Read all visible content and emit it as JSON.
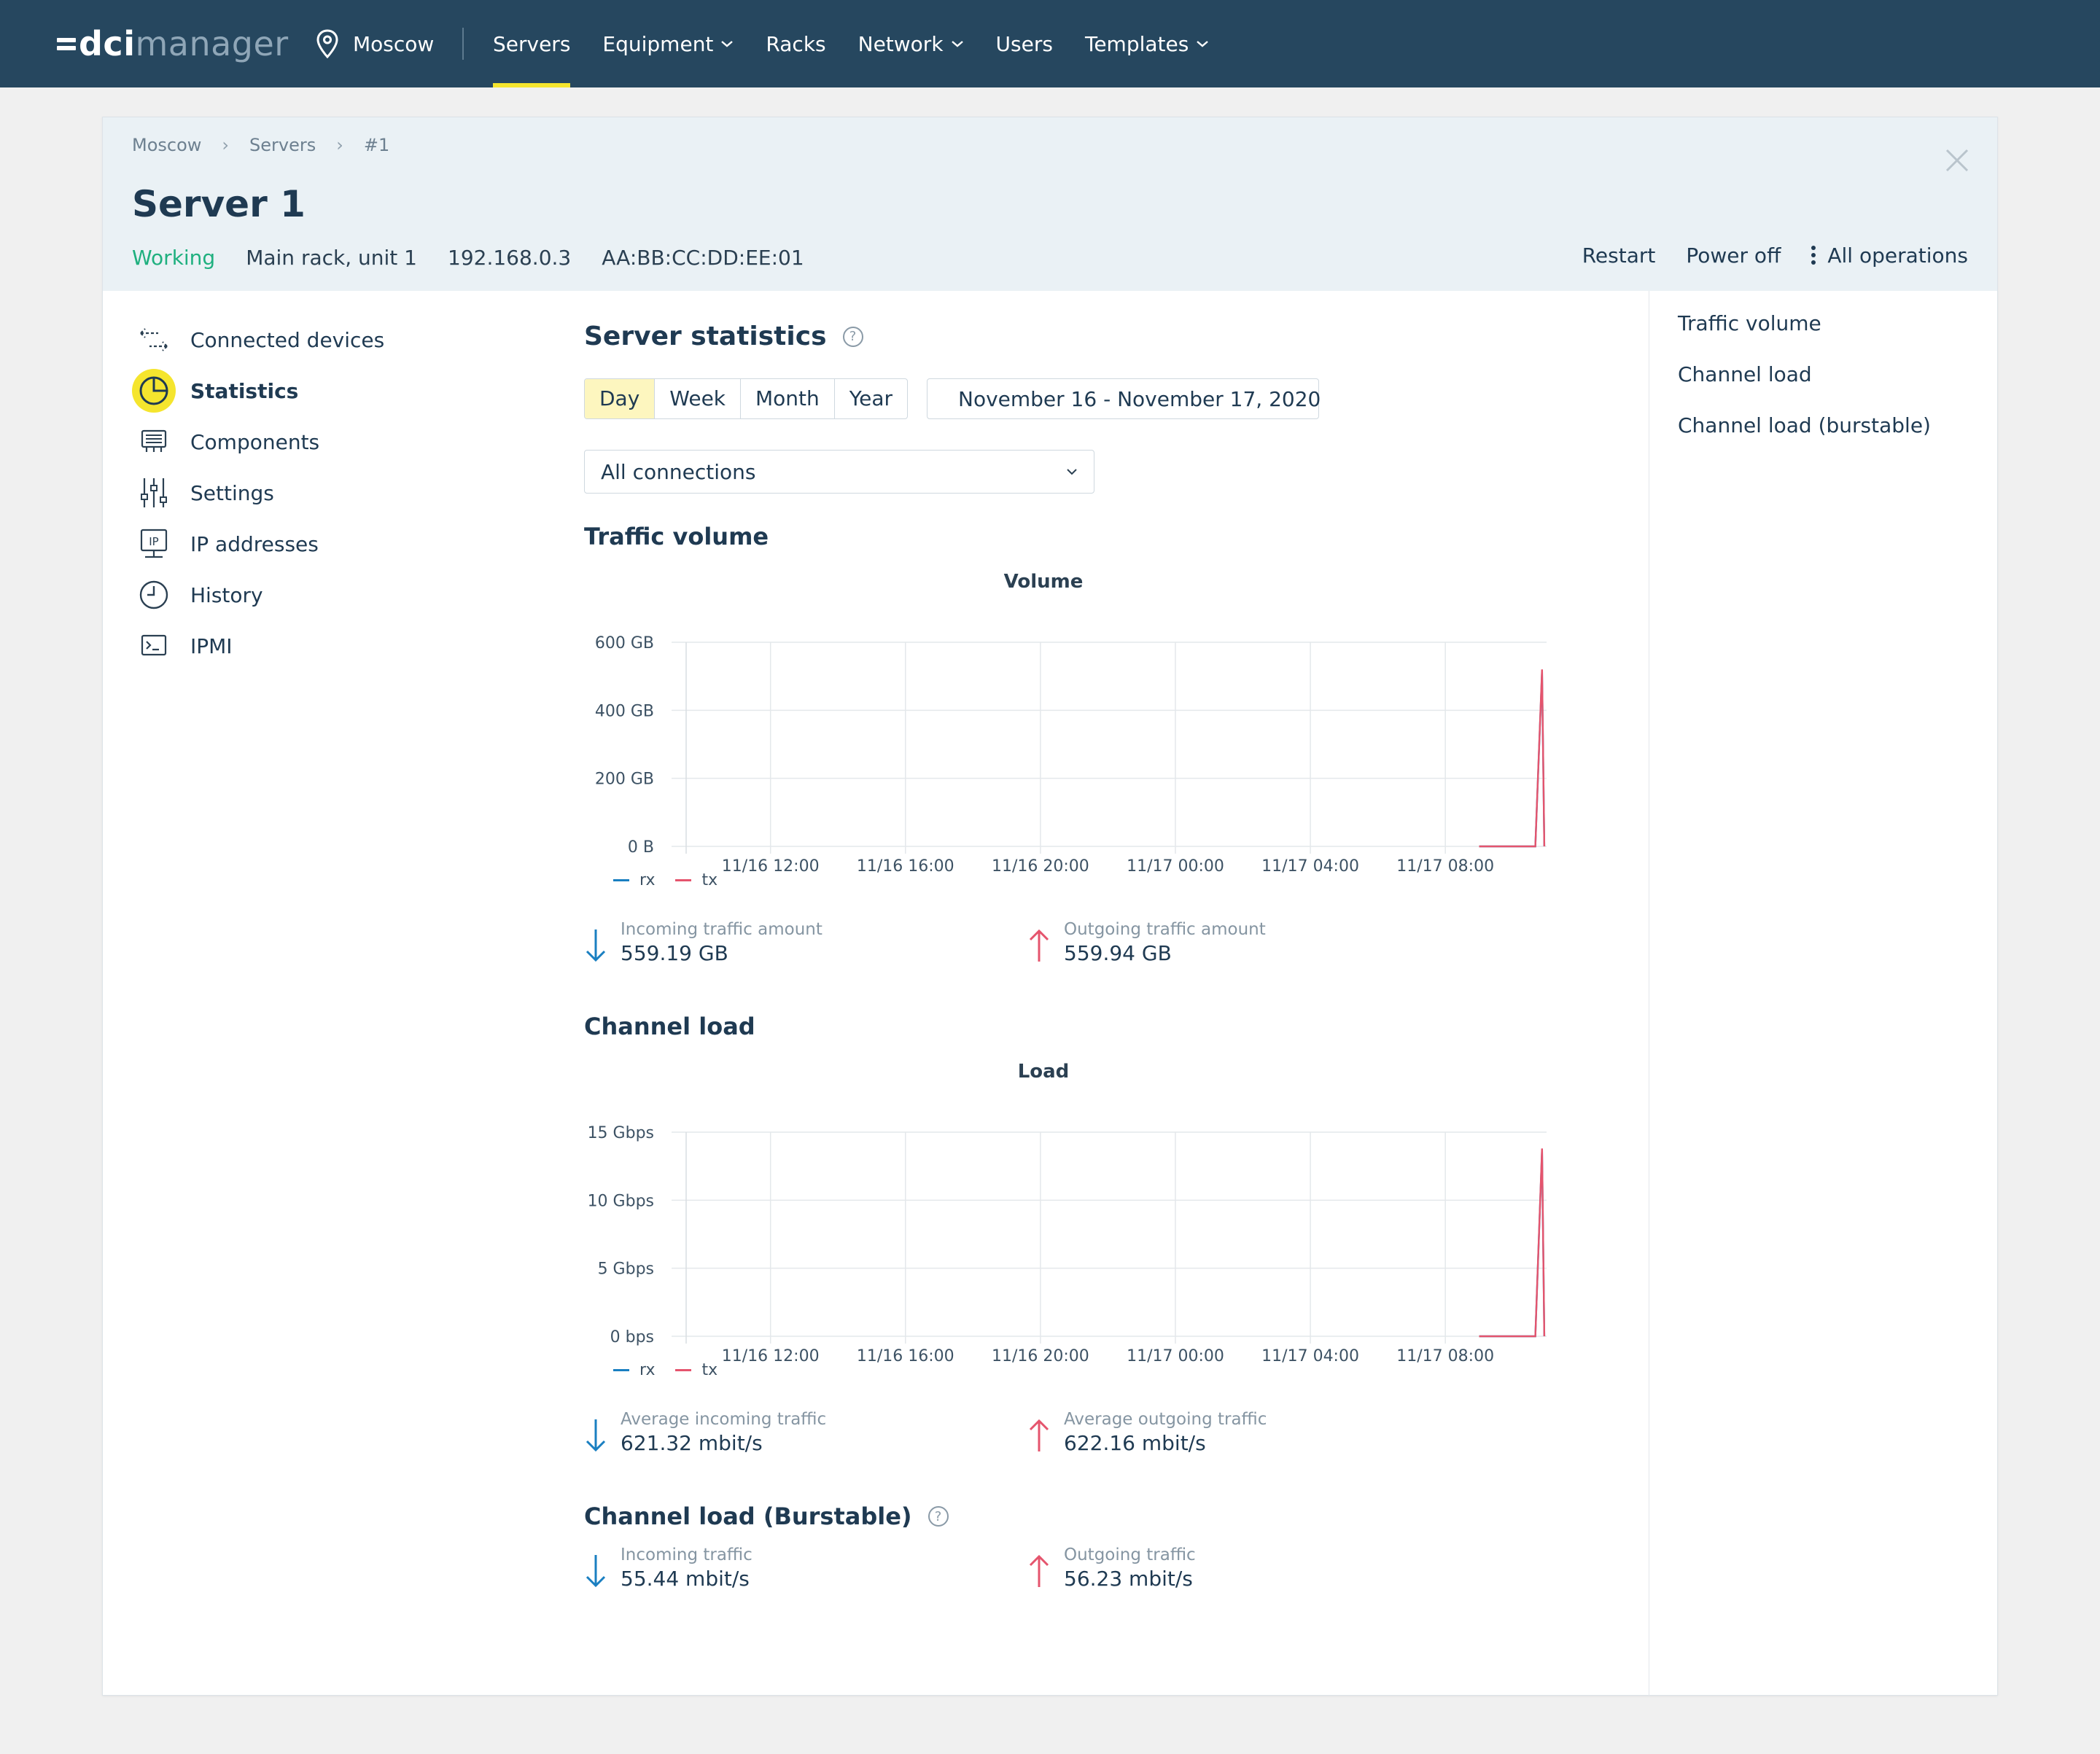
{
  "app": {
    "logo_dci": "dci",
    "logo_manager": "manager",
    "location": "Moscow"
  },
  "nav": [
    {
      "label": "Servers",
      "dropdown": false,
      "active": true
    },
    {
      "label": "Equipment",
      "dropdown": true,
      "active": false
    },
    {
      "label": "Racks",
      "dropdown": false,
      "active": false
    },
    {
      "label": "Network",
      "dropdown": true,
      "active": false
    },
    {
      "label": "Users",
      "dropdown": false,
      "active": false
    },
    {
      "label": "Templates",
      "dropdown": true,
      "active": false
    }
  ],
  "breadcrumb": [
    "Moscow",
    "Servers",
    "#1"
  ],
  "breadcrumb_sep": "›",
  "server": {
    "title": "Server 1",
    "status": "Working",
    "rack": "Main rack, unit 1",
    "ip": "192.168.0.3",
    "mac": "AA:BB:CC:DD:EE:01"
  },
  "actions": {
    "restart": "Restart",
    "power_off": "Power off",
    "all_operations": "All operations"
  },
  "sidemenu": [
    {
      "label": "Connected devices",
      "icon": "connected-devices-icon"
    },
    {
      "label": "Statistics",
      "icon": "pie-chart-icon",
      "active": true
    },
    {
      "label": "Components",
      "icon": "components-icon"
    },
    {
      "label": "Settings",
      "icon": "sliders-icon"
    },
    {
      "label": "IP addresses",
      "icon": "ip-icon"
    },
    {
      "label": "History",
      "icon": "clock-icon"
    },
    {
      "label": "IPMI",
      "icon": "terminal-icon"
    }
  ],
  "rightmenu": [
    "Traffic volume",
    "Channel load",
    "Channel load (burstable)"
  ],
  "stats": {
    "title": "Server statistics",
    "help": "?",
    "periods": [
      "Day",
      "Week",
      "Month",
      "Year"
    ],
    "active_period": "Day",
    "date_range": "November 16 - November 17, 2020",
    "connection_select": "All connections"
  },
  "traffic": {
    "heading": "Traffic volume",
    "in_label": "Incoming traffic amount",
    "in_value": "559.19 GB",
    "out_label": "Outgoing traffic amount",
    "out_value": "559.94 GB"
  },
  "load": {
    "heading": "Channel load",
    "in_label": "Average incoming traffic",
    "in_value": "621.32 mbit/s",
    "out_label": "Average outgoing traffic",
    "out_value": "622.16 mbit/s"
  },
  "burst": {
    "heading": "Channel load (Burstable)",
    "help": "?",
    "in_label": "Incoming traffic",
    "in_value": "55.44 mbit/s",
    "out_label": "Outgoing traffic",
    "out_value": "56.23 mbit/s"
  },
  "colors": {
    "rx": "#1a7fc1",
    "tx": "#e5546d",
    "accent": "#f5e52e",
    "status_ok": "#1fb07f"
  },
  "chart_data": [
    {
      "type": "line",
      "title": "Volume",
      "y_ticks": [
        "0 B",
        "200 GB",
        "400 GB",
        "600 GB"
      ],
      "ylim": [
        0,
        600
      ],
      "y_unit": "GB",
      "x_ticks": [
        "11/16 12:00",
        "11/16 16:00",
        "11/16 20:00",
        "11/17 00:00",
        "11/17 04:00",
        "11/17 08:00"
      ],
      "x_range": [
        "11/16 09:30",
        "11/17 11:00"
      ],
      "series": [
        {
          "name": "rx",
          "x": [
            "11/17 09:00",
            "11/17 10:40",
            "11/17 10:52",
            "11/17 10:56"
          ],
          "values": [
            0,
            0,
            515,
            0
          ]
        },
        {
          "name": "tx",
          "x": [
            "11/17 09:00",
            "11/17 10:40",
            "11/17 10:52",
            "11/17 10:56"
          ],
          "values": [
            0,
            0,
            520,
            0
          ]
        }
      ],
      "grid": true,
      "legend": "bottom-left"
    },
    {
      "type": "line",
      "title": "Load",
      "y_ticks": [
        "0 bps",
        "5 Gbps",
        "10 Gbps",
        "15 Gbps"
      ],
      "ylim": [
        0,
        15
      ],
      "y_unit": "Gbps",
      "x_ticks": [
        "11/16 12:00",
        "11/16 16:00",
        "11/16 20:00",
        "11/17 00:00",
        "11/17 04:00",
        "11/17 08:00"
      ],
      "x_range": [
        "11/16 09:30",
        "11/17 11:00"
      ],
      "series": [
        {
          "name": "rx",
          "x": [
            "11/17 09:00",
            "11/17 10:40",
            "11/17 10:52",
            "11/17 10:56"
          ],
          "values": [
            0,
            0,
            13.7,
            0
          ]
        },
        {
          "name": "tx",
          "x": [
            "11/17 09:00",
            "11/17 10:40",
            "11/17 10:52",
            "11/17 10:56"
          ],
          "values": [
            0,
            0,
            13.8,
            0
          ]
        }
      ],
      "grid": true,
      "legend": "bottom-left"
    }
  ]
}
